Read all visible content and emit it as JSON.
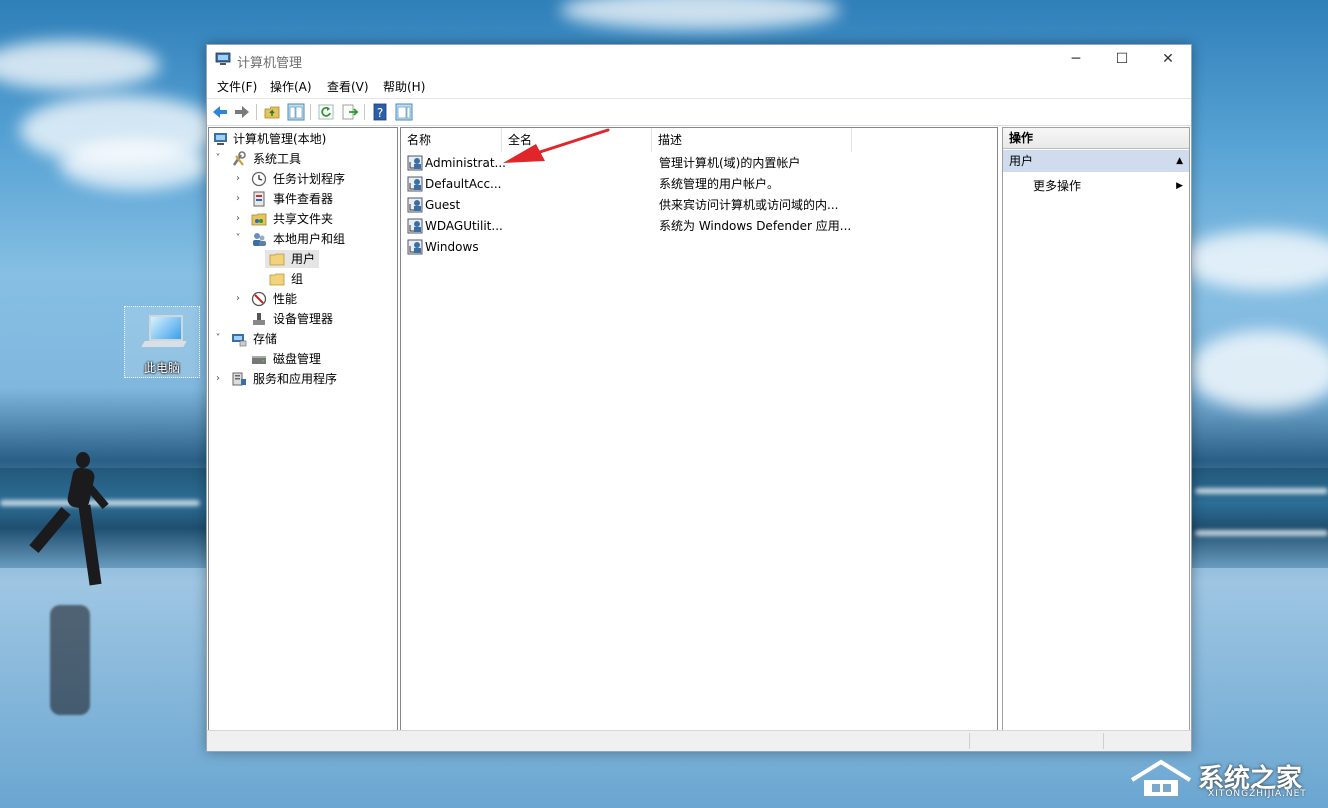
{
  "desktop": {
    "icon_label": "此电脑"
  },
  "window": {
    "title": "计算机管理",
    "controls": {
      "minimize": "─",
      "maximize": "☐",
      "close": "✕"
    }
  },
  "menubar": {
    "items": [
      "文件(F)",
      "操作(A)",
      "查看(V)",
      "帮助(H)"
    ]
  },
  "tree": {
    "root": "计算机管理(本地)",
    "system_tools": "系统工具",
    "task_scheduler": "任务计划程序",
    "event_viewer": "事件查看器",
    "shared_folders": "共享文件夹",
    "local_users_groups": "本地用户和组",
    "users": "用户",
    "groups": "组",
    "performance": "性能",
    "device_manager": "设备管理器",
    "storage": "存储",
    "disk_management": "磁盘管理",
    "services_apps": "服务和应用程序"
  },
  "list": {
    "columns": [
      "名称",
      "全名",
      "描述"
    ],
    "rows": [
      {
        "name": "Administrat...",
        "fullname": "",
        "description": "管理计算机(域)的内置帐户"
      },
      {
        "name": "DefaultAcc...",
        "fullname": "",
        "description": "系统管理的用户帐户。"
      },
      {
        "name": "Guest",
        "fullname": "",
        "description": "供来宾访问计算机或访问域的内..."
      },
      {
        "name": "WDAGUtilit...",
        "fullname": "",
        "description": "系统为 Windows Defender 应用..."
      },
      {
        "name": "Windows",
        "fullname": "",
        "description": ""
      }
    ]
  },
  "actions": {
    "header": "操作",
    "section": "用户",
    "more": "更多操作"
  },
  "watermark": {
    "text": "系统之家",
    "sub": "XITONGZHIJIA.NET"
  },
  "colors": {
    "selection": "#cfdcee",
    "arrow": "#e0262a"
  }
}
